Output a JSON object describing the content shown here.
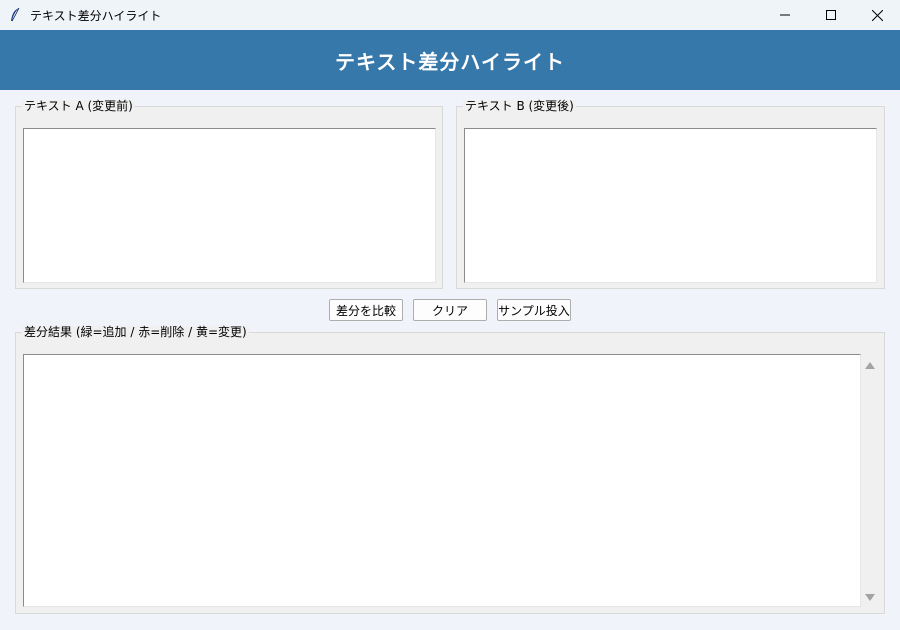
{
  "window": {
    "title": "テキスト差分ハイライト",
    "app_icon": "feather-icon",
    "controls": [
      "minimize-icon",
      "maximize-icon",
      "close-icon"
    ]
  },
  "header": {
    "title": "テキスト差分ハイライト",
    "background": "#3778ab",
    "text_color": "#ffffff"
  },
  "text_a": {
    "label": "テキスト A (変更前)",
    "value": ""
  },
  "text_b": {
    "label": "テキスト B (変更後)",
    "value": ""
  },
  "buttons": {
    "compare": "差分を比較",
    "clear": "クリア",
    "sample": "サンプル投入"
  },
  "result": {
    "label": "差分結果 (緑=追加 / 赤=削除 / 黄=変更)",
    "value": ""
  }
}
